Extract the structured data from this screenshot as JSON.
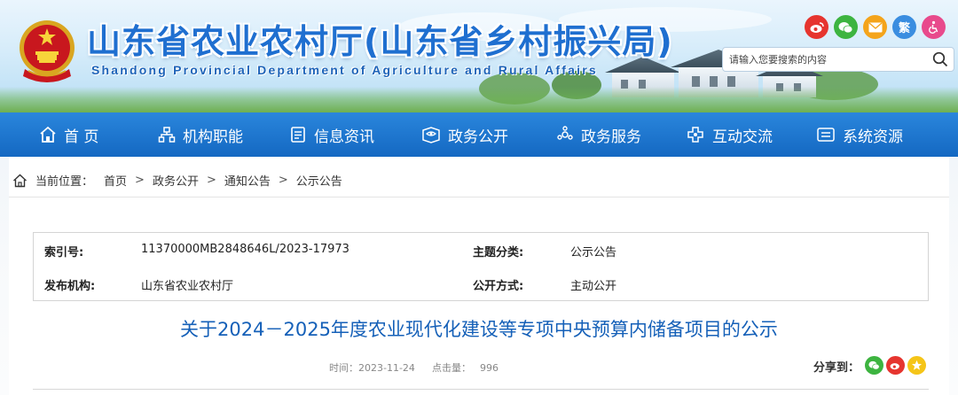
{
  "header": {
    "title": "山东省农业农村厅(山东省乡村振兴局)",
    "subtitle": "Shandong Provincial Department of Agriculture and Rural Affairs",
    "share_icons": [
      "weibo-icon",
      "wechat-icon",
      "mail-icon",
      "traditional-chinese-toggle",
      "accessibility-icon"
    ],
    "trad_label": "繁",
    "search": {
      "placeholder": "请输入您要搜索的内容"
    }
  },
  "nav": {
    "items": [
      {
        "label": "首 页",
        "icon": "home-icon"
      },
      {
        "label": "机构职能",
        "icon": "org-icon"
      },
      {
        "label": "信息资讯",
        "icon": "document-icon"
      },
      {
        "label": "政务公开",
        "icon": "open-affairs-icon"
      },
      {
        "label": "政务服务",
        "icon": "service-icon"
      },
      {
        "label": "互动交流",
        "icon": "interaction-icon"
      },
      {
        "label": "系统资源",
        "icon": "system-icon"
      }
    ]
  },
  "breadcrumb": {
    "prefix": "当前位置：",
    "items": [
      "首页",
      "政务公开",
      "通知公告",
      "公示公告"
    ],
    "separator": ">"
  },
  "info": {
    "index_label": "索引号:",
    "index_value": "11370000MB2848646L/2023-17973",
    "topic_label": "主题分类:",
    "topic_value": "公示公告",
    "publisher_label": "发布机构:",
    "publisher_value": "山东省农业农村厅",
    "method_label": "公开方式:",
    "method_value": "主动公开"
  },
  "article": {
    "title": "关于2024－2025年度农业现代化建设等专项中央预算内储备项目的公示",
    "time_label": "时间：",
    "time_value": "2023-11-24",
    "clicks_label": "点击量：",
    "clicks_value": "996",
    "share_label": "分享到："
  },
  "colors": {
    "brand_blue": "#1f6fd0",
    "nav_blue": "#1468c2",
    "title_blue": "#1560b8"
  }
}
